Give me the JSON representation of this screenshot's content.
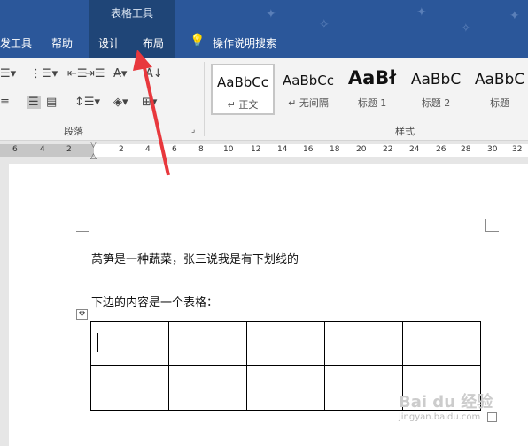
{
  "titlebar": {
    "context_group": "表格工具",
    "tabs": [
      "发工具",
      "帮助",
      "设计",
      "布局",
      "操作说明搜索"
    ]
  },
  "ribbon": {
    "group_paragraph": "段落",
    "group_styles": "样式",
    "styles": [
      {
        "sample": "AaBbCc",
        "name": "正文"
      },
      {
        "sample": "AaBbCc",
        "name": "无间隔"
      },
      {
        "sample": "AaBł",
        "name": "标题 1"
      },
      {
        "sample": "AaBbC",
        "name": "标题 2"
      },
      {
        "sample": "AaBbC",
        "name": "标题"
      }
    ],
    "paragraph_icons": [
      "bullets-icon",
      "numbering-icon",
      "multilevel-icon",
      "decrease-indent-icon",
      "increase-indent-icon",
      "chinese-layout-icon",
      "align-right-icon",
      "justify-icon",
      "distributed-icon",
      "line-spacing-icon",
      "shading-icon",
      "borders-icon"
    ]
  },
  "ruler": {
    "ticks": [
      "6",
      "4",
      "2",
      "2",
      "4",
      "6",
      "8",
      "10",
      "12",
      "14",
      "16",
      "18",
      "20",
      "22",
      "24",
      "26",
      "28",
      "30",
      "32"
    ]
  },
  "document": {
    "line1": "莴笋是一种蔬菜，张三说我是有下划线的",
    "line2": "下边的内容是一个表格：",
    "table": {
      "rows": 2,
      "cols": 5
    }
  },
  "watermark": {
    "brand": "Bai du 经验",
    "url": "jingyan.baidu.com"
  },
  "colors": {
    "title_bar": "#2b579a",
    "context_tab": "#1f4577",
    "arrow": "#e8383d"
  }
}
